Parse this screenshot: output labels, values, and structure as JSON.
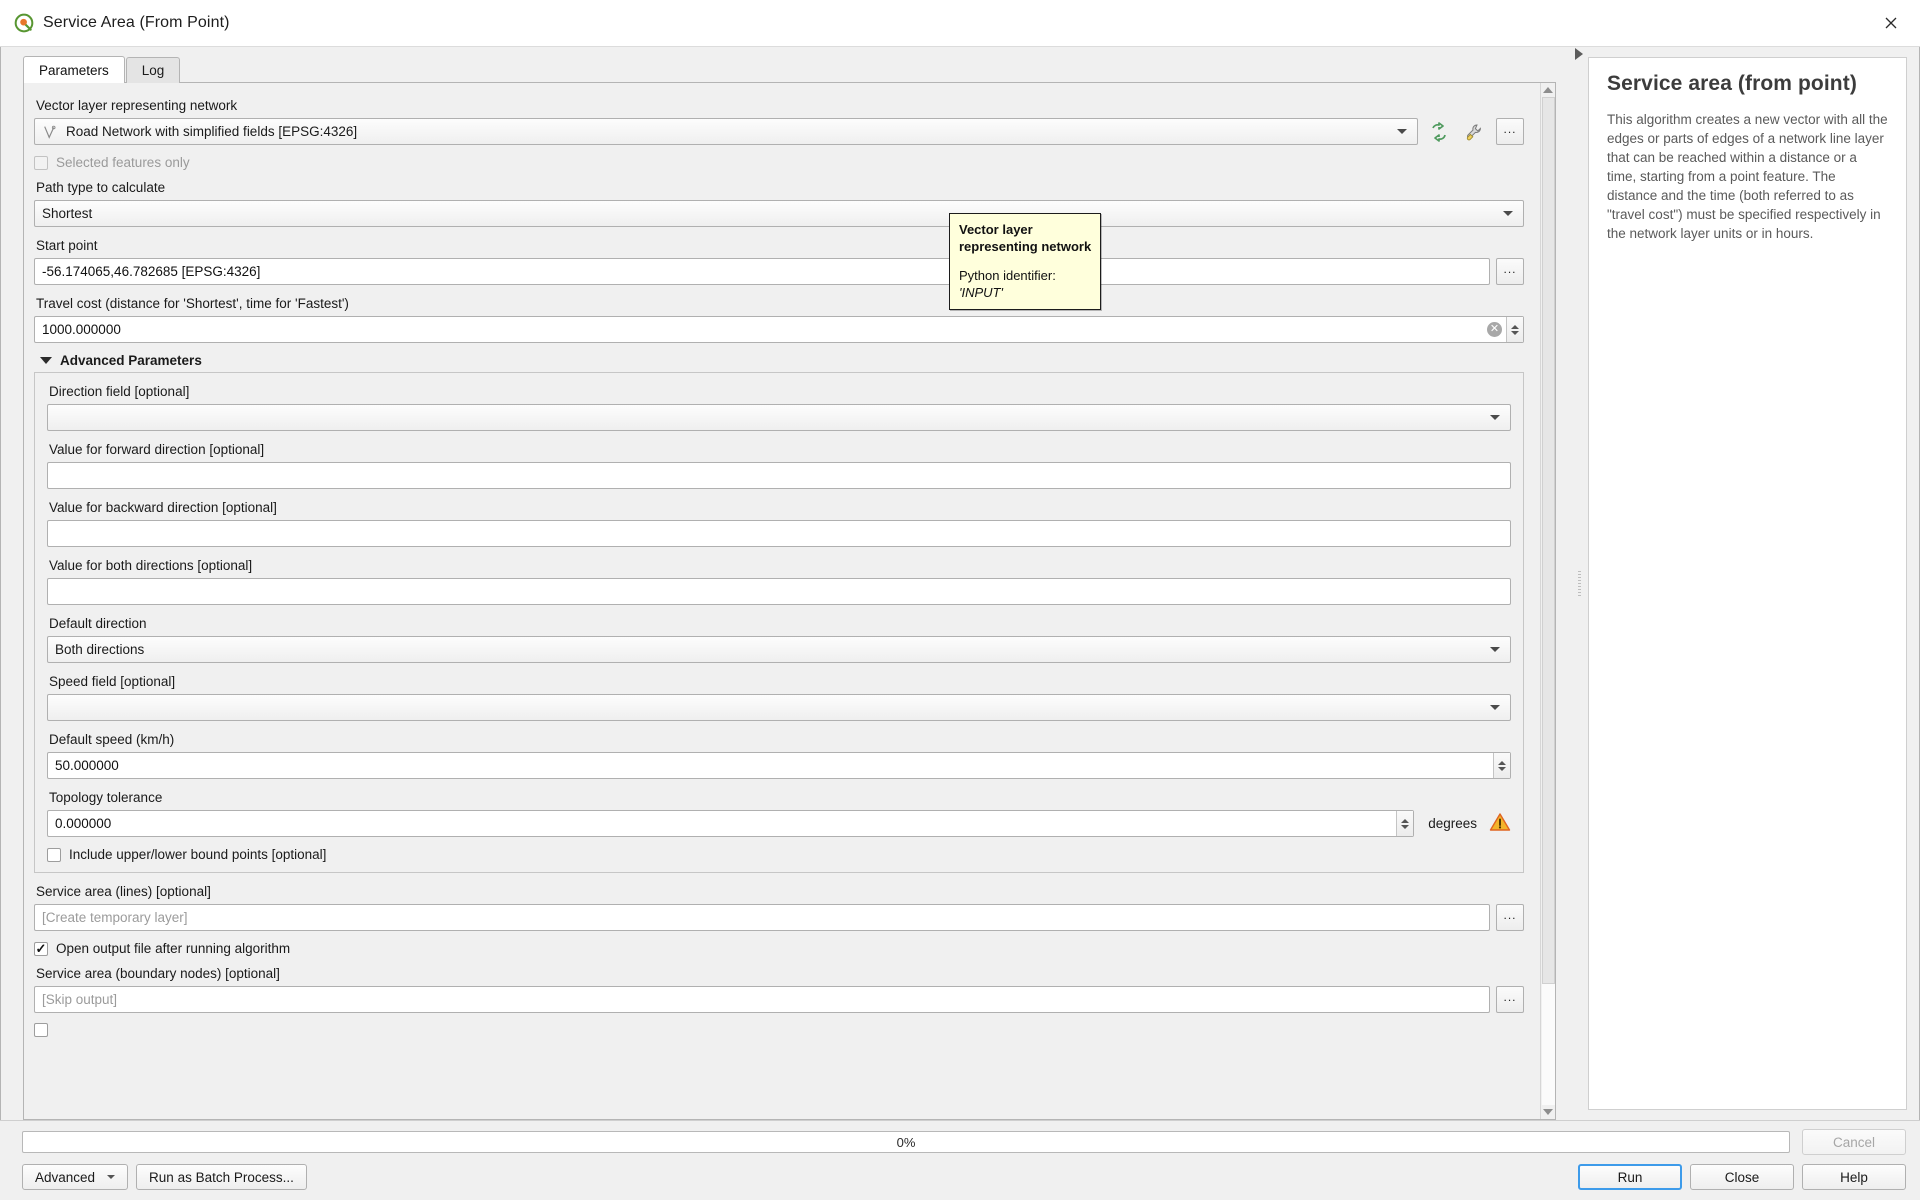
{
  "window": {
    "title": "Service Area (From Point)",
    "logo_icon": "qgis-logo-icon",
    "close_icon": "close-icon"
  },
  "tabs": [
    {
      "label": "Parameters",
      "active": true
    },
    {
      "label": "Log",
      "active": false
    }
  ],
  "parameters": {
    "input_layer": {
      "label": "Vector layer representing network",
      "value": "Road Network with simplified fields [EPSG:4326]",
      "layer_icon": "line-layer-icon",
      "iterate_icon": "iterate-icon",
      "expression_icon": "wrench-icon",
      "browse_label": "..."
    },
    "selected_features_only": {
      "label": "Selected features only",
      "checked": false,
      "enabled": false
    },
    "path_type": {
      "label": "Path type to calculate",
      "value": "Shortest"
    },
    "start_point": {
      "label": "Start point",
      "value": "-56.174065,46.782685 [EPSG:4326]",
      "browse_label": "..."
    },
    "travel_cost": {
      "label": "Travel cost (distance for 'Shortest', time for 'Fastest')",
      "value": "1000.000000",
      "clear_icon": "clear-icon"
    }
  },
  "advanced": {
    "title": "Advanced Parameters",
    "expanded": true,
    "direction_field": {
      "label": "Direction field [optional]",
      "value": ""
    },
    "forward_value": {
      "label": "Value for forward direction [optional]",
      "value": ""
    },
    "backward_value": {
      "label": "Value for backward direction [optional]",
      "value": ""
    },
    "both_value": {
      "label": "Value for both directions [optional]",
      "value": ""
    },
    "default_direction": {
      "label": "Default direction",
      "value": "Both directions"
    },
    "speed_field": {
      "label": "Speed field [optional]",
      "value": ""
    },
    "default_speed": {
      "label": "Default speed (km/h)",
      "value": "50.000000"
    },
    "topology_tolerance": {
      "label": "Topology tolerance",
      "value": "0.000000",
      "units": "degrees",
      "warning_icon": "warning-icon"
    },
    "include_bounds": {
      "label": "Include upper/lower bound points [optional]",
      "checked": false
    }
  },
  "outputs": {
    "service_area_lines": {
      "label": "Service area (lines) [optional]",
      "value": "",
      "placeholder": "[Create temporary layer]",
      "browse_label": "..."
    },
    "open_output": {
      "label": "Open output file after running algorithm",
      "checked": true
    },
    "service_area_nodes": {
      "label": "Service area (boundary nodes) [optional]",
      "value": "",
      "placeholder": "[Skip output]",
      "browse_label": "..."
    }
  },
  "tooltip": {
    "title": "Vector layer representing network",
    "identifier_prefix": "Python identifier: ",
    "identifier": "'INPUT'"
  },
  "help": {
    "title": "Service area (from point)",
    "body": "This algorithm creates a new vector with all the edges or parts of edges of a network line layer that can be reached within a distance or a time, starting from a point feature. The distance and the time (both referred to as \"travel cost\") must be specified respectively in the network layer units or in hours."
  },
  "footer": {
    "progress_text": "0%",
    "progress_percent": 0,
    "cancel_label": "Cancel",
    "advanced_label": "Advanced",
    "batch_label": "Run as Batch Process...",
    "run_label": "Run",
    "close_label": "Close",
    "help_label": "Help"
  },
  "colors": {
    "tooltip_bg": "#ffffdc",
    "focus_blue": "#3d9bea",
    "warning_orange": "#f5a623",
    "iterate_green": "#5aa469"
  }
}
